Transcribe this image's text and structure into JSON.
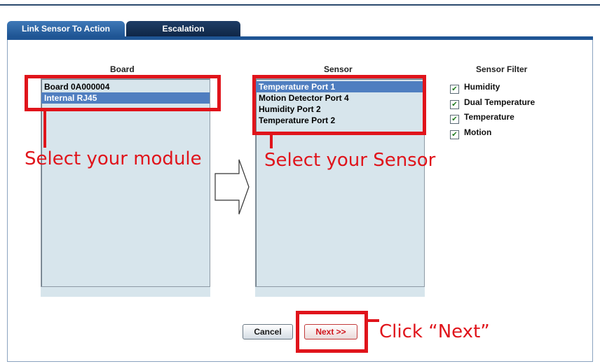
{
  "tabs": [
    {
      "label": "Link Sensor To Action"
    },
    {
      "label": "Escalation"
    }
  ],
  "board": {
    "title": "Board",
    "items": [
      "Board 0A000004",
      "Internal RJ45"
    ],
    "selected_index": 1
  },
  "sensor": {
    "title": "Sensor",
    "items": [
      "Temperature Port 1",
      "Motion Detector Port 4",
      "Humidity Port 2",
      "Temperature Port 2"
    ],
    "selected_index": 0
  },
  "sensor_filter": {
    "title": "Sensor Filter",
    "options": [
      {
        "label": "Humidity",
        "checked": true
      },
      {
        "label": "Dual Temperature",
        "checked": true
      },
      {
        "label": "Temperature",
        "checked": true
      },
      {
        "label": "Motion",
        "checked": true
      }
    ]
  },
  "annotations": {
    "select_module": "Select your module",
    "select_sensor": "Select your Sensor",
    "click_next": "Click “Next”"
  },
  "buttons": {
    "cancel": "Cancel",
    "next": "Next >>"
  },
  "colors": {
    "annotation_red": "#e0141b",
    "tab_active": "#1f5594",
    "tab_inactive": "#0f2646",
    "listbox_bg": "#d7e5ec",
    "selection": "#4f7ec0"
  }
}
